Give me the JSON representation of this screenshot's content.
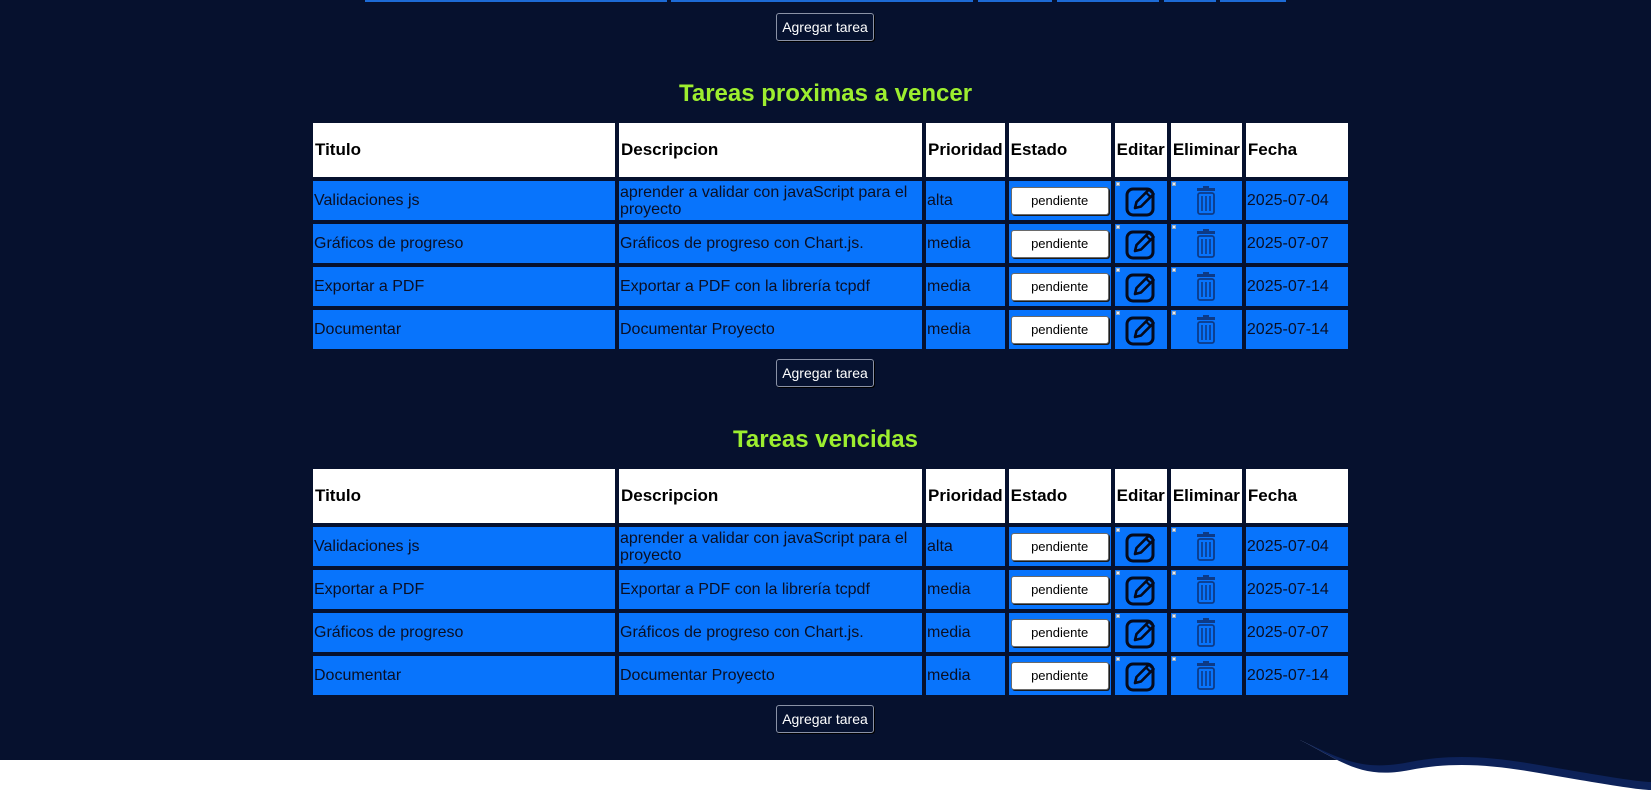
{
  "add_task_label": "Agregar tarea",
  "columns": [
    "Titulo",
    "Descripcion",
    "Prioridad",
    "Estado",
    "Editar",
    "Eliminar",
    "Fecha"
  ],
  "sections": [
    {
      "title": "Tareas proximas a vencer",
      "rows": [
        {
          "titulo": "Validaciones js",
          "descripcion": "aprender a validar con javaScript para el proyecto",
          "prioridad": "alta",
          "estado": "pendiente",
          "fecha": "2025-07-04"
        },
        {
          "titulo": "Gráficos de progreso",
          "descripcion": "Gráficos de progreso con Chart.js.",
          "prioridad": "media",
          "estado": "pendiente",
          "fecha": "2025-07-07"
        },
        {
          "titulo": "Exportar a PDF",
          "descripcion": "Exportar a PDF con la librería tcpdf",
          "prioridad": "media",
          "estado": "pendiente",
          "fecha": "2025-07-14"
        },
        {
          "titulo": "Documentar",
          "descripcion": "Documentar Proyecto",
          "prioridad": "media",
          "estado": "pendiente",
          "fecha": "2025-07-14"
        }
      ]
    },
    {
      "title": "Tareas vencidas",
      "rows": [
        {
          "titulo": "Validaciones js",
          "descripcion": "aprender a validar con javaScript para el proyecto",
          "prioridad": "alta",
          "estado": "pendiente",
          "fecha": "2025-07-04"
        },
        {
          "titulo": "Exportar a PDF",
          "descripcion": "Exportar a PDF con la librería tcpdf",
          "prioridad": "media",
          "estado": "pendiente",
          "fecha": "2025-07-14"
        },
        {
          "titulo": "Gráficos de progreso",
          "descripcion": "Gráficos de progreso con Chart.js.",
          "prioridad": "media",
          "estado": "pendiente",
          "fecha": "2025-07-07"
        },
        {
          "titulo": "Documentar",
          "descripcion": "Documentar Proyecto",
          "prioridad": "media",
          "estado": "pendiente",
          "fecha": "2025-07-14"
        }
      ]
    }
  ],
  "colors": {
    "page_bg": "#06112e",
    "row_bg": "#0874fc",
    "title_color": "#9dee2f",
    "header_bg": "#ffffff"
  },
  "icons": {
    "edit": "edit-icon",
    "delete": "trash-icon"
  }
}
